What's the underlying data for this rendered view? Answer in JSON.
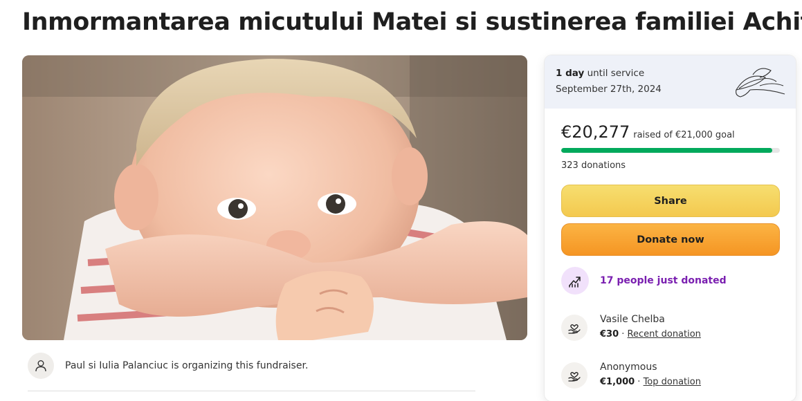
{
  "campaign": {
    "title": "Inmormantarea micutului Matei si sustinerea familiei Achitei",
    "image_alt": "Photo of a smiling toddler resting chin on his arms"
  },
  "organizer": {
    "text": "Paul si Iulia Palanciuc is organizing this fundraiser."
  },
  "service": {
    "days": "1 day",
    "until_label": "until service",
    "date": "September 27th, 2024",
    "icon": "lily-flower-icon"
  },
  "donations": {
    "raised": "€20,277",
    "goal_text": "raised of €21,000 goal",
    "progress_fraction": 0.9656,
    "count_text": "323 donations",
    "progress_color": "#02a95c"
  },
  "buttons": {
    "share": "Share",
    "donate": "Donate now"
  },
  "recent_activity": {
    "text": "17 people just donated",
    "icon": "trending-up-icon"
  },
  "donors": [
    {
      "name": "Vasile Chelba",
      "amount": "€30",
      "separator": " · ",
      "tag": "Recent donation",
      "icon": "heart-hand-icon"
    },
    {
      "name": "Anonymous",
      "amount": "€1,000",
      "separator": " · ",
      "tag": "Top donation",
      "icon": "heart-hand-icon"
    }
  ],
  "colors": {
    "accent_purple": "#7a1fb0",
    "share_button": "#f4c94f",
    "donate_button": "#f59523",
    "service_banner": "#eef1f8"
  }
}
